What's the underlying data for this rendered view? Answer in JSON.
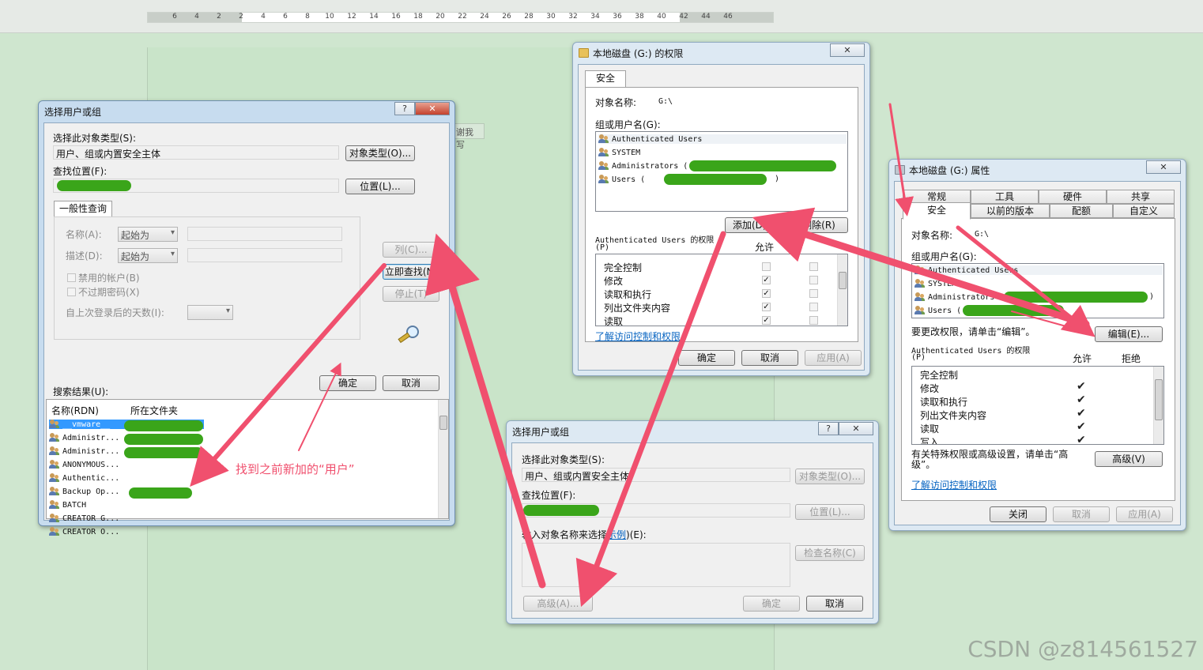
{
  "background": {
    "ruler_ticks": [
      "6",
      "4",
      "2",
      "2",
      "4",
      "6",
      "8",
      "10",
      "12",
      "14",
      "16",
      "18",
      "20",
      "22",
      "24",
      "26",
      "28",
      "30",
      "32",
      "34",
      "36",
      "38",
      "40",
      "42",
      "44",
      "46"
    ],
    "snippet": "谢我写",
    "watermark": "CSDN @z814561527",
    "annotation": "找到之前新加的“用户”"
  },
  "colors": {
    "arrow": "#f0506e",
    "redact": "#3aa51a",
    "link": "#0563c1",
    "selection": "#3399ff"
  },
  "dialog_a": {
    "title": "选择用户或组",
    "help_btn": "?",
    "close_btn": "✕",
    "object_type_label": "选择此对象类型(S):",
    "object_type_value": "用户、组或内置安全主体",
    "object_type_button": "对象类型(O)...",
    "location_label": "查找位置(F):",
    "location_button": "位置(L)...",
    "tab": "一般性查询",
    "name_label": "名称(A):",
    "name_combo": "起始为",
    "desc_label": "描述(D):",
    "desc_combo": "起始为",
    "disabled_accounts": "禁用的帐户(B)",
    "no_expire_pwd": "不过期密码(X)",
    "days_label": "自上次登录后的天数(I):",
    "columns_button": "列(C)...",
    "find_now_button": "立即查找(N)",
    "stop_button": "停止(T)",
    "ok_button": "确定",
    "cancel_button": "取消",
    "results_label": "搜索结果(U):",
    "col_name": "名称(RDN)",
    "col_folder": "所在文件夹",
    "rows": [
      "__vmware__",
      "Administr...",
      "Administr...",
      "ANONYMOUS...",
      "Authentic...",
      "Backup Op...",
      "BATCH",
      "CREATOR G...",
      "CREATOR O..."
    ]
  },
  "dialog_b": {
    "title": "本地磁盘 (G:) 的权限",
    "close_btn": "✕",
    "tab": "安全",
    "object_name_label": "对象名称:",
    "object_name_value": "G:\\",
    "group_label": "组或用户名(G):",
    "users": [
      "Authenticated Users",
      "SYSTEM",
      "Administrators (",
      "Users ("
    ],
    "users_tail": [
      ")",
      ")"
    ],
    "add_button": "添加(D)...",
    "remove_button": "删除(R)",
    "perm_label": "Authenticated Users 的权限",
    "perm_label2": "(P)",
    "allow_header": "允许",
    "perms": [
      "完全控制",
      "修改",
      "读取和执行",
      "列出文件夹内容",
      "读取"
    ],
    "perm_checks": [
      "",
      "✓",
      "✓",
      "✓",
      "✓"
    ],
    "learn_link": "了解访问控制和权限",
    "ok_button": "确定",
    "cancel_button": "取消",
    "apply_button": "应用(A)"
  },
  "dialog_c": {
    "title": "本地磁盘 (G:) 属性",
    "close_btn": "✕",
    "tabs_row1": [
      "常规",
      "工具",
      "硬件",
      "共享"
    ],
    "tabs_row2": [
      "安全",
      "以前的版本",
      "配额",
      "自定义"
    ],
    "object_name_label": "对象名称:",
    "object_name_value": "G:\\",
    "group_label": "组或用户名(G):",
    "users": [
      "Authenticated Users",
      "SYSTEM",
      "Administrators (",
      "Users ("
    ],
    "users_tail": [
      ")",
      ")"
    ],
    "edit_hint": "要更改权限，请单击“编辑”。",
    "edit_button": "编辑(E)...",
    "perm_label": "Authenticated Users 的权限",
    "perm_label2": "(P)",
    "allow_header": "允许",
    "deny_header": "拒绝",
    "perms": [
      "完全控制",
      "修改",
      "读取和执行",
      "列出文件夹内容",
      "读取",
      "写入"
    ],
    "perm_checks": [
      "",
      "✔",
      "✔",
      "✔",
      "✔",
      "✔"
    ],
    "special_hint": "有关特殊权限或高级设置，请单击“高级”。",
    "advanced_button": "高级(V)",
    "learn_link": "了解访问控制和权限",
    "close_button": "关闭",
    "cancel_button": "取消",
    "apply_button": "应用(A)"
  },
  "dialog_d": {
    "title": "选择用户或组",
    "help_btn": "?",
    "close_btn": "✕",
    "object_type_label": "选择此对象类型(S):",
    "object_type_value": "用户、组或内置安全主体",
    "object_type_button": "对象类型(O)...",
    "location_label": "查找位置(F):",
    "location_button": "位置(L)...",
    "enter_label": "输入对象名称来选择",
    "enter_link": "示例",
    "enter_suffix": ")(E):",
    "check_names_button": "检查名称(C)",
    "advanced_button": "高级(A)...",
    "ok_button": "确定",
    "cancel_button": "取消"
  }
}
